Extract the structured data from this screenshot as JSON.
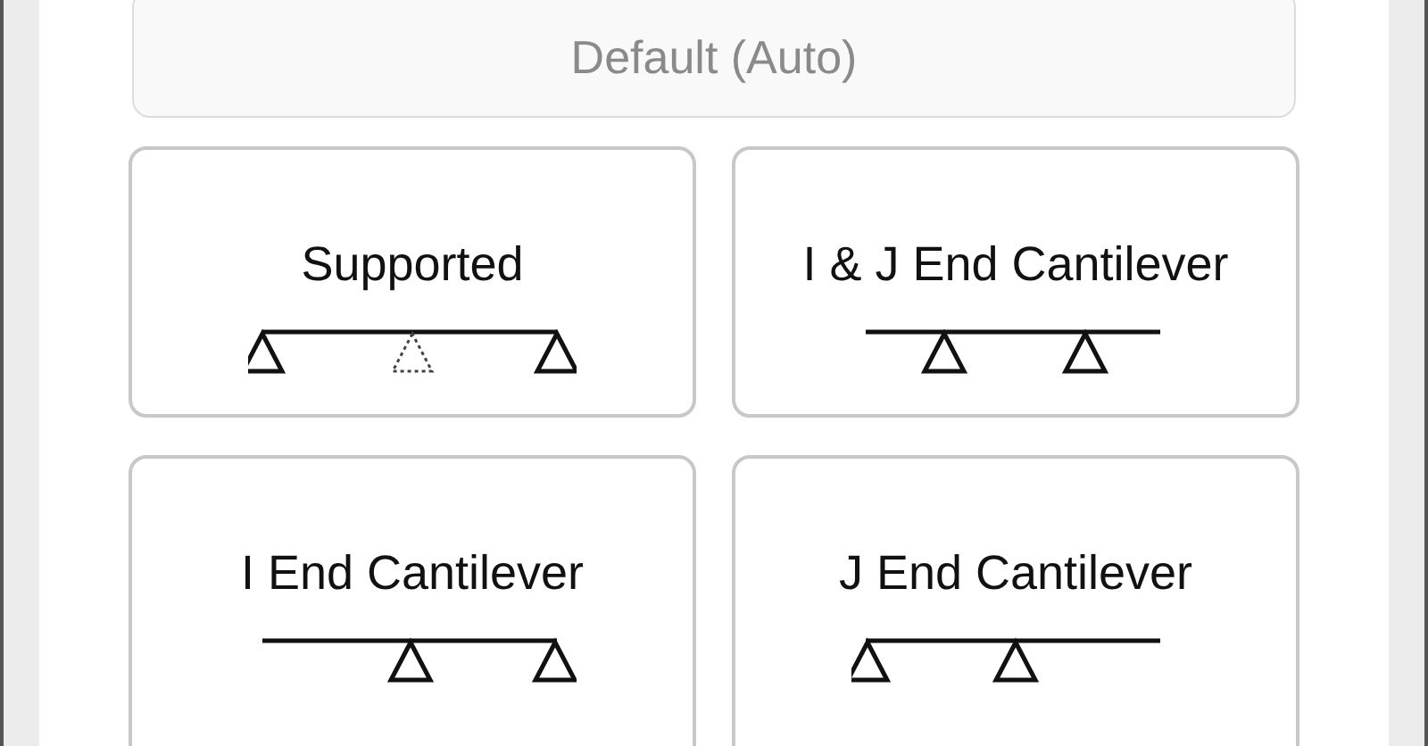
{
  "default_button": {
    "label": "Default (Auto)",
    "disabled": true
  },
  "options": [
    {
      "label": "Supported",
      "kind": "supported"
    },
    {
      "label": "I & J End Cantilever",
      "kind": "both_cantilever"
    },
    {
      "label": "I End Cantilever",
      "kind": "i_cantilever"
    },
    {
      "label": "J End Cantilever",
      "kind": "j_cantilever"
    }
  ]
}
